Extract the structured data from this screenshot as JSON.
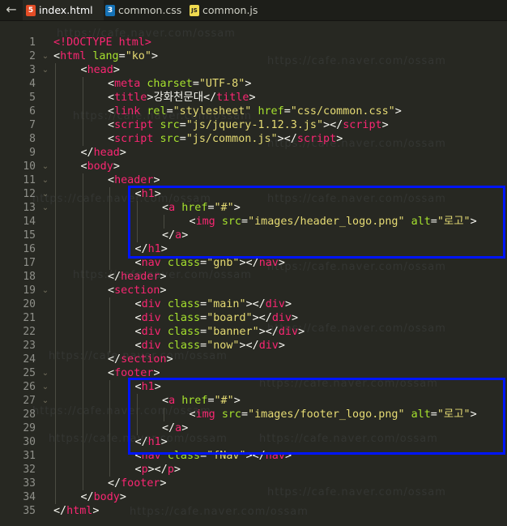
{
  "toolbar": {
    "back_label": "←"
  },
  "tabs": [
    {
      "label": "index.html",
      "icon": "html5-icon",
      "badge": "5",
      "color": "#e44d26",
      "active": true
    },
    {
      "label": "common.css",
      "icon": "css3-icon",
      "badge": "3",
      "color": "#1572b6",
      "active": false
    },
    {
      "label": "common.js",
      "icon": "js-icon",
      "badge": "JS",
      "color": "#f0db4f",
      "active": false
    }
  ],
  "colors": {
    "tag": "#f92672",
    "attr": "#a6e22e",
    "string": "#e6db74",
    "text": "#f8f8f2",
    "punct": "#f8f8f2",
    "highlight_box": "#0015ff"
  },
  "watermark": "https://cafe.naver.com/ossam",
  "lines": [
    {
      "n": 1,
      "indent": 0,
      "fold": false,
      "tokens": [
        [
          "t",
          "<!DOCTYPE html>"
        ]
      ]
    },
    {
      "n": 2,
      "indent": 0,
      "fold": true,
      "tokens": [
        [
          "p",
          "<"
        ],
        [
          "t",
          "html"
        ],
        [
          "p",
          " "
        ],
        [
          "a",
          "lang"
        ],
        [
          "p",
          "="
        ],
        [
          "s",
          "\"ko\""
        ],
        [
          "p",
          ">"
        ]
      ]
    },
    {
      "n": 3,
      "indent": 1,
      "fold": true,
      "tokens": [
        [
          "p",
          "<"
        ],
        [
          "t",
          "head"
        ],
        [
          "p",
          ">"
        ]
      ]
    },
    {
      "n": 4,
      "indent": 2,
      "fold": false,
      "tokens": [
        [
          "p",
          "<"
        ],
        [
          "t",
          "meta"
        ],
        [
          "p",
          " "
        ],
        [
          "a",
          "charset"
        ],
        [
          "p",
          "="
        ],
        [
          "s",
          "\"UTF-8\""
        ],
        [
          "p",
          ">"
        ]
      ]
    },
    {
      "n": 5,
      "indent": 2,
      "fold": false,
      "tokens": [
        [
          "p",
          "<"
        ],
        [
          "t",
          "title"
        ],
        [
          "p",
          ">"
        ],
        [
          "x",
          "강화천문대"
        ],
        [
          "p",
          "</"
        ],
        [
          "t",
          "title"
        ],
        [
          "p",
          ">"
        ]
      ]
    },
    {
      "n": 6,
      "indent": 2,
      "fold": false,
      "tokens": [
        [
          "p",
          "<"
        ],
        [
          "t",
          "link"
        ],
        [
          "p",
          " "
        ],
        [
          "a",
          "rel"
        ],
        [
          "p",
          "="
        ],
        [
          "s",
          "\"stylesheet\""
        ],
        [
          "p",
          " "
        ],
        [
          "a",
          "href"
        ],
        [
          "p",
          "="
        ],
        [
          "s",
          "\"css/common.css\""
        ],
        [
          "p",
          ">"
        ]
      ]
    },
    {
      "n": 7,
      "indent": 2,
      "fold": false,
      "tokens": [
        [
          "p",
          "<"
        ],
        [
          "t",
          "script"
        ],
        [
          "p",
          " "
        ],
        [
          "a",
          "src"
        ],
        [
          "p",
          "="
        ],
        [
          "s",
          "\"js/jquery-1.12.3.js\""
        ],
        [
          "p",
          "></"
        ],
        [
          "t",
          "script"
        ],
        [
          "p",
          ">"
        ]
      ]
    },
    {
      "n": 8,
      "indent": 2,
      "fold": false,
      "tokens": [
        [
          "p",
          "<"
        ],
        [
          "t",
          "script"
        ],
        [
          "p",
          " "
        ],
        [
          "a",
          "src"
        ],
        [
          "p",
          "="
        ],
        [
          "s",
          "\"js/common.js\""
        ],
        [
          "p",
          "></"
        ],
        [
          "t",
          "script"
        ],
        [
          "p",
          ">"
        ]
      ]
    },
    {
      "n": 9,
      "indent": 1,
      "fold": false,
      "tokens": [
        [
          "p",
          "</"
        ],
        [
          "t",
          "head"
        ],
        [
          "p",
          ">"
        ]
      ]
    },
    {
      "n": 10,
      "indent": 1,
      "fold": true,
      "tokens": [
        [
          "p",
          "<"
        ],
        [
          "t",
          "body"
        ],
        [
          "p",
          ">"
        ]
      ]
    },
    {
      "n": 11,
      "indent": 2,
      "fold": true,
      "tokens": [
        [
          "p",
          "<"
        ],
        [
          "t",
          "header"
        ],
        [
          "p",
          ">"
        ]
      ]
    },
    {
      "n": 12,
      "indent": 3,
      "fold": true,
      "tokens": [
        [
          "p",
          "<"
        ],
        [
          "t",
          "h1"
        ],
        [
          "p",
          ">"
        ]
      ]
    },
    {
      "n": 13,
      "indent": 4,
      "fold": true,
      "tokens": [
        [
          "p",
          "<"
        ],
        [
          "t",
          "a"
        ],
        [
          "p",
          " "
        ],
        [
          "a",
          "href"
        ],
        [
          "p",
          "="
        ],
        [
          "s",
          "\"#\""
        ],
        [
          "p",
          ">"
        ]
      ]
    },
    {
      "n": 14,
      "indent": 5,
      "fold": false,
      "tokens": [
        [
          "p",
          "<"
        ],
        [
          "t",
          "img"
        ],
        [
          "p",
          " "
        ],
        [
          "a",
          "src"
        ],
        [
          "p",
          "="
        ],
        [
          "s",
          "\"images/header_logo.png\""
        ],
        [
          "p",
          " "
        ],
        [
          "a",
          "alt"
        ],
        [
          "p",
          "="
        ],
        [
          "s",
          "\"로고\""
        ],
        [
          "p",
          ">"
        ]
      ]
    },
    {
      "n": 15,
      "indent": 4,
      "fold": false,
      "tokens": [
        [
          "p",
          "</"
        ],
        [
          "t",
          "a"
        ],
        [
          "p",
          ">"
        ]
      ]
    },
    {
      "n": 16,
      "indent": 3,
      "fold": false,
      "tokens": [
        [
          "p",
          "</"
        ],
        [
          "t",
          "h1"
        ],
        [
          "p",
          ">"
        ]
      ]
    },
    {
      "n": 17,
      "indent": 3,
      "fold": false,
      "tokens": [
        [
          "p",
          "<"
        ],
        [
          "t",
          "nav"
        ],
        [
          "p",
          " "
        ],
        [
          "a",
          "class"
        ],
        [
          "p",
          "="
        ],
        [
          "s",
          "\"gnb\""
        ],
        [
          "p",
          "></"
        ],
        [
          "t",
          "nav"
        ],
        [
          "p",
          ">"
        ]
      ]
    },
    {
      "n": 18,
      "indent": 2,
      "fold": false,
      "tokens": [
        [
          "p",
          "</"
        ],
        [
          "t",
          "header"
        ],
        [
          "p",
          ">"
        ]
      ]
    },
    {
      "n": 19,
      "indent": 2,
      "fold": true,
      "tokens": [
        [
          "p",
          "<"
        ],
        [
          "t",
          "section"
        ],
        [
          "p",
          ">"
        ]
      ]
    },
    {
      "n": 20,
      "indent": 3,
      "fold": false,
      "tokens": [
        [
          "p",
          "<"
        ],
        [
          "t",
          "div"
        ],
        [
          "p",
          " "
        ],
        [
          "a",
          "class"
        ],
        [
          "p",
          "="
        ],
        [
          "s",
          "\"main\""
        ],
        [
          "p",
          "></"
        ],
        [
          "t",
          "div"
        ],
        [
          "p",
          ">"
        ]
      ]
    },
    {
      "n": 21,
      "indent": 3,
      "fold": false,
      "tokens": [
        [
          "p",
          "<"
        ],
        [
          "t",
          "div"
        ],
        [
          "p",
          " "
        ],
        [
          "a",
          "class"
        ],
        [
          "p",
          "="
        ],
        [
          "s",
          "\"board\""
        ],
        [
          "p",
          "></"
        ],
        [
          "t",
          "div"
        ],
        [
          "p",
          ">"
        ]
      ]
    },
    {
      "n": 22,
      "indent": 3,
      "fold": false,
      "tokens": [
        [
          "p",
          "<"
        ],
        [
          "t",
          "div"
        ],
        [
          "p",
          " "
        ],
        [
          "a",
          "class"
        ],
        [
          "p",
          "="
        ],
        [
          "s",
          "\"banner\""
        ],
        [
          "p",
          "></"
        ],
        [
          "t",
          "div"
        ],
        [
          "p",
          ">"
        ]
      ]
    },
    {
      "n": 23,
      "indent": 3,
      "fold": false,
      "tokens": [
        [
          "p",
          "<"
        ],
        [
          "t",
          "div"
        ],
        [
          "p",
          " "
        ],
        [
          "a",
          "class"
        ],
        [
          "p",
          "="
        ],
        [
          "s",
          "\"now\""
        ],
        [
          "p",
          "></"
        ],
        [
          "t",
          "div"
        ],
        [
          "p",
          ">"
        ]
      ]
    },
    {
      "n": 24,
      "indent": 2,
      "fold": false,
      "tokens": [
        [
          "p",
          "</"
        ],
        [
          "t",
          "section"
        ],
        [
          "p",
          ">"
        ]
      ]
    },
    {
      "n": 25,
      "indent": 2,
      "fold": true,
      "tokens": [
        [
          "p",
          "<"
        ],
        [
          "t",
          "footer"
        ],
        [
          "p",
          ">"
        ]
      ]
    },
    {
      "n": 26,
      "indent": 3,
      "fold": true,
      "tokens": [
        [
          "p",
          "<"
        ],
        [
          "t",
          "h1"
        ],
        [
          "p",
          ">"
        ]
      ]
    },
    {
      "n": 27,
      "indent": 4,
      "fold": true,
      "tokens": [
        [
          "p",
          "<"
        ],
        [
          "t",
          "a"
        ],
        [
          "p",
          " "
        ],
        [
          "a",
          "href"
        ],
        [
          "p",
          "="
        ],
        [
          "s",
          "\"#\""
        ],
        [
          "p",
          ">"
        ]
      ]
    },
    {
      "n": 28,
      "indent": 5,
      "fold": false,
      "tokens": [
        [
          "p",
          "<"
        ],
        [
          "t",
          "img"
        ],
        [
          "p",
          " "
        ],
        [
          "a",
          "src"
        ],
        [
          "p",
          "="
        ],
        [
          "s",
          "\"images/footer_logo.png\""
        ],
        [
          "p",
          " "
        ],
        [
          "a",
          "alt"
        ],
        [
          "p",
          "="
        ],
        [
          "s",
          "\"로고\""
        ],
        [
          "p",
          ">"
        ]
      ]
    },
    {
      "n": 29,
      "indent": 4,
      "fold": false,
      "tokens": [
        [
          "p",
          "</"
        ],
        [
          "t",
          "a"
        ],
        [
          "p",
          ">"
        ]
      ]
    },
    {
      "n": 30,
      "indent": 3,
      "fold": false,
      "tokens": [
        [
          "p",
          "</"
        ],
        [
          "t",
          "h1"
        ],
        [
          "p",
          ">"
        ]
      ]
    },
    {
      "n": 31,
      "indent": 3,
      "fold": false,
      "tokens": [
        [
          "p",
          "<"
        ],
        [
          "t",
          "nav"
        ],
        [
          "p",
          " "
        ],
        [
          "a",
          "class"
        ],
        [
          "p",
          "="
        ],
        [
          "s",
          "\"fNav\""
        ],
        [
          "p",
          "></"
        ],
        [
          "t",
          "nav"
        ],
        [
          "p",
          ">"
        ]
      ]
    },
    {
      "n": 32,
      "indent": 3,
      "fold": false,
      "tokens": [
        [
          "p",
          "<"
        ],
        [
          "t",
          "p"
        ],
        [
          "p",
          "></"
        ],
        [
          "t",
          "p"
        ],
        [
          "p",
          ">"
        ]
      ]
    },
    {
      "n": 33,
      "indent": 2,
      "fold": false,
      "tokens": [
        [
          "p",
          "</"
        ],
        [
          "t",
          "footer"
        ],
        [
          "p",
          ">"
        ]
      ]
    },
    {
      "n": 34,
      "indent": 1,
      "fold": false,
      "tokens": [
        [
          "p",
          "</"
        ],
        [
          "t",
          "body"
        ],
        [
          "p",
          ">"
        ]
      ]
    },
    {
      "n": 35,
      "indent": 0,
      "fold": false,
      "tokens": [
        [
          "p",
          "</"
        ],
        [
          "t",
          "html"
        ],
        [
          "p",
          ">"
        ]
      ]
    }
  ]
}
